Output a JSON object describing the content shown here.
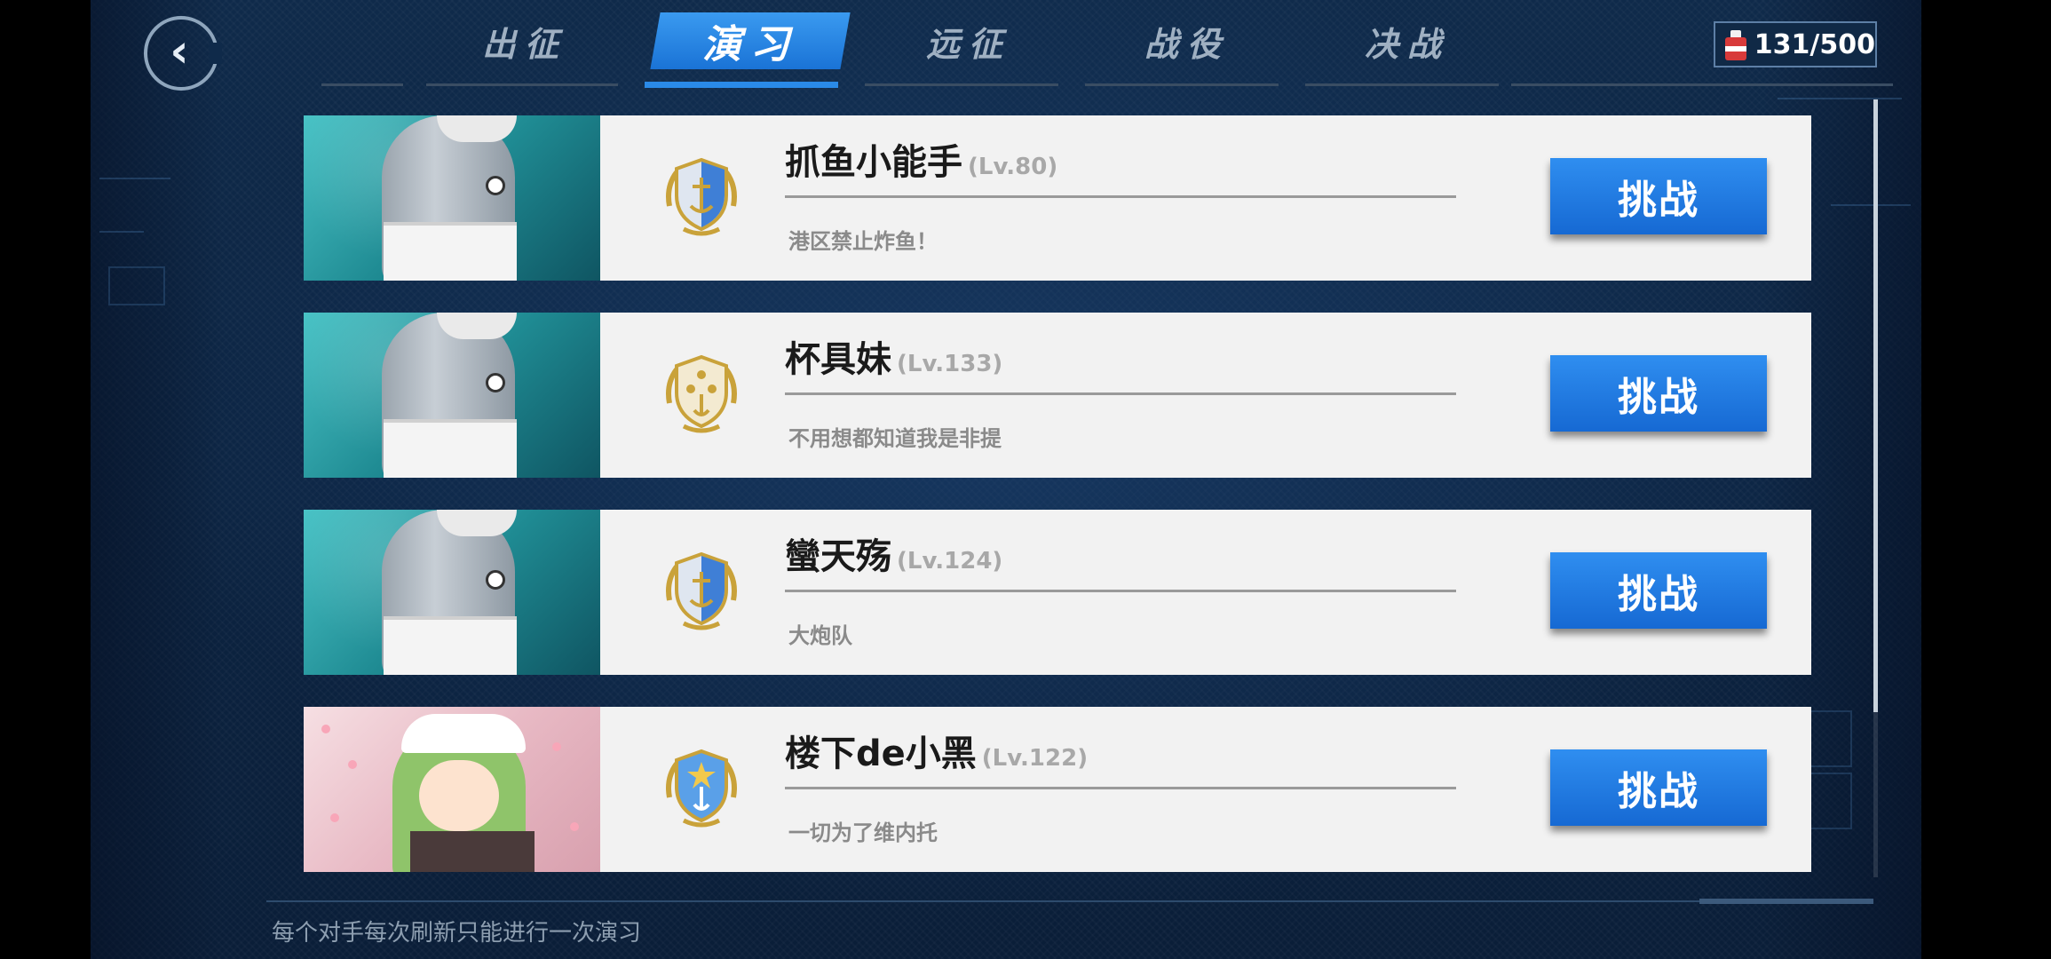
{
  "nav": {
    "back_label": "‹",
    "tabs": [
      {
        "label": "出征",
        "active": false
      },
      {
        "label": "演习",
        "active": true
      },
      {
        "label": "远征",
        "active": false
      },
      {
        "label": "战役",
        "active": false
      },
      {
        "label": "决战",
        "active": false
      }
    ]
  },
  "resource": {
    "icon": "oil-barrel-icon",
    "value": "131/500"
  },
  "opponents": [
    {
      "name": "抓鱼小能手",
      "level": "(Lv.80)",
      "motto": "港区禁止炸鱼！",
      "rank_icon": "shield-anchor-rank-icon",
      "avatar": "fish",
      "button": "挑战"
    },
    {
      "name": "杯具妹",
      "level": "(Lv.133)",
      "motto": "不用想都知道我是非提",
      "rank_icon": "shield-three-stars-rank-icon",
      "avatar": "fish",
      "button": "挑战"
    },
    {
      "name": "蠻天殇",
      "level": "(Lv.124)",
      "motto": "大炮队",
      "rank_icon": "shield-anchor-rank-icon",
      "avatar": "fish",
      "button": "挑战"
    },
    {
      "name": "楼下de小黑",
      "level": "(Lv.122)",
      "motto": "一切为了维内托",
      "rank_icon": "shield-star-rank-icon",
      "avatar": "girl",
      "button": "挑战"
    }
  ],
  "footer": {
    "note": "每个对手每次刷新只能进行一次演习"
  },
  "colors": {
    "accent": "#1f7ae0",
    "background": "#0f2a4a",
    "card": "#f2f2f2"
  }
}
